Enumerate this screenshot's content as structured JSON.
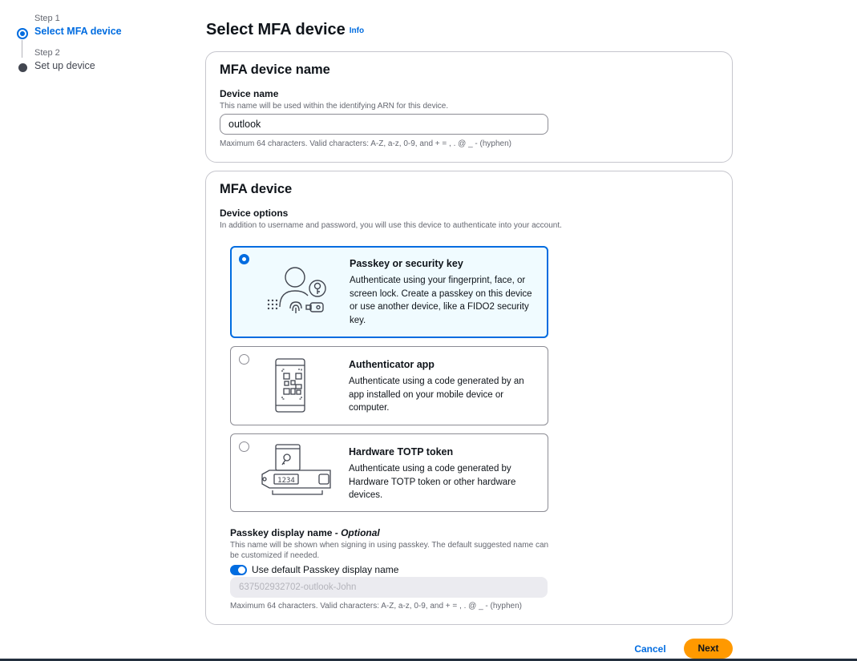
{
  "stepper": {
    "steps": [
      {
        "number": "Step 1",
        "label": "Select MFA device",
        "state": "active"
      },
      {
        "number": "Step 2",
        "label": "Set up device",
        "state": "pending"
      }
    ]
  },
  "header": {
    "title": "Select MFA device",
    "info_link": "Info"
  },
  "device_name_section": {
    "title": "MFA device name",
    "field_label": "Device name",
    "field_description": "This name will be used within the identifying ARN for this device.",
    "value": "outlook",
    "constraint": "Maximum 64 characters. Valid characters: A-Z, a-z, 0-9, and + = , . @ _ - (hyphen)"
  },
  "mfa_device_section": {
    "title": "MFA device",
    "options_label": "Device options",
    "options_description": "In addition to username and password, you will use this device to authenticate into your account.",
    "options": [
      {
        "title": "Passkey or security key",
        "description": "Authenticate using your fingerprint, face, or screen lock. Create a passkey on this device or use another device, like a FIDO2 security key.",
        "selected": true,
        "icon": "passkey-icon"
      },
      {
        "title": "Authenticator app",
        "description": "Authenticate using a code generated by an app installed on your mobile device or computer.",
        "selected": false,
        "icon": "authenticator-app-icon"
      },
      {
        "title": "Hardware TOTP token",
        "description": "Authenticate using a code generated by Hardware TOTP token or other hardware devices.",
        "selected": false,
        "icon": "hardware-token-icon",
        "token_code": "1234"
      }
    ],
    "passkey_display": {
      "label": "Passkey display name",
      "label_optional": " - Optional",
      "description": "This name will be shown when signing in using passkey. The default suggested name can be customized if needed.",
      "toggle_label": "Use default Passkey display name",
      "toggle_on": true,
      "value": "637502932702-outlook-John",
      "constraint": "Maximum 64 characters. Valid characters: A-Z, a-z, 0-9, and + = , . @ _ - (hyphen)"
    }
  },
  "footer": {
    "cancel_label": "Cancel",
    "next_label": "Next"
  },
  "colors": {
    "accent": "#006ce0",
    "primary_button": "#ff9900",
    "selected_tile_bg": "#f0fbff"
  }
}
